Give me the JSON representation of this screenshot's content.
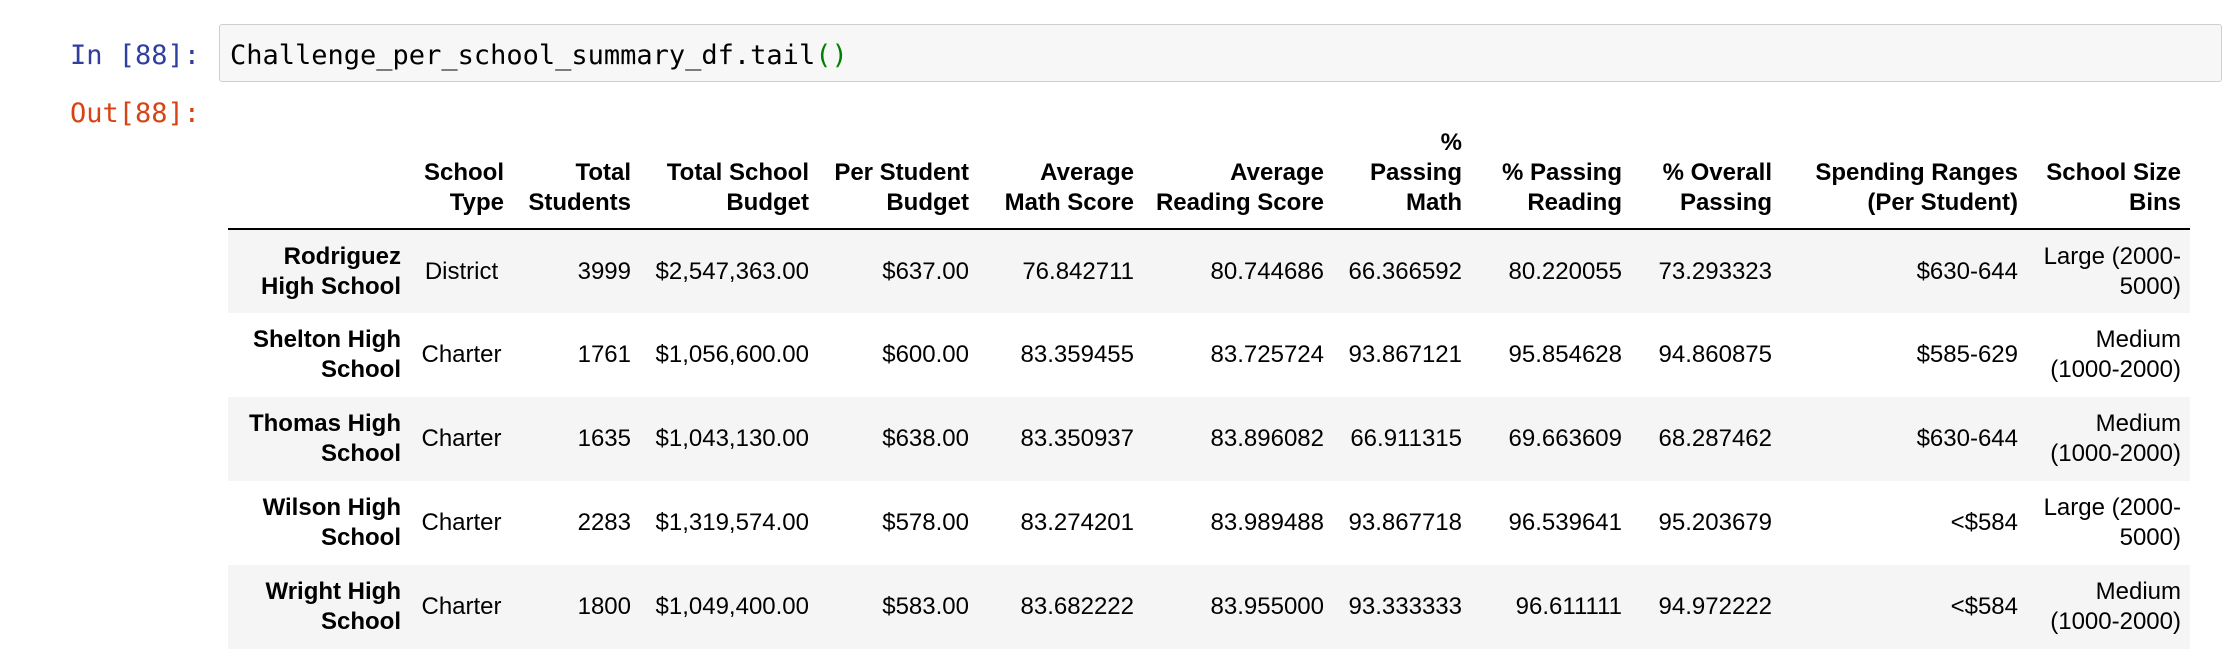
{
  "cell": {
    "in_prompt": "In [88]:",
    "out_prompt": "Out[88]:",
    "code": {
      "text": "Challenge_per_school_summary_df.tail",
      "parens": "()"
    }
  },
  "colors": {
    "in_prompt": "#303f9f",
    "out_prompt": "#d84315",
    "code_parens": "#008000",
    "stripe": "#f5f5f5"
  },
  "table": {
    "columns": [
      "",
      "School Type",
      "Total Students",
      "Total School Budget",
      "Per Student Budget",
      "Average Math Score",
      "Average Reading Score",
      "% Passing Math",
      "% Passing Reading",
      "% Overall Passing",
      "Spending Ranges (Per Student)",
      "School Size Bins"
    ],
    "rows": [
      {
        "index": "Rodriguez High School",
        "cells": [
          "District",
          "3999",
          "$2,547,363.00",
          "$637.00",
          "76.842711",
          "80.744686",
          "66.366592",
          "80.220055",
          "73.293323",
          "$630-644",
          "Large (2000-5000)"
        ]
      },
      {
        "index": "Shelton High School",
        "cells": [
          "Charter",
          "1761",
          "$1,056,600.00",
          "$600.00",
          "83.359455",
          "83.725724",
          "93.867121",
          "95.854628",
          "94.860875",
          "$585-629",
          "Medium (1000-2000)"
        ]
      },
      {
        "index": "Thomas High School",
        "cells": [
          "Charter",
          "1635",
          "$1,043,130.00",
          "$638.00",
          "83.350937",
          "83.896082",
          "66.911315",
          "69.663609",
          "68.287462",
          "$630-644",
          "Medium (1000-2000)"
        ]
      },
      {
        "index": "Wilson High School",
        "cells": [
          "Charter",
          "2283",
          "$1,319,574.00",
          "$578.00",
          "83.274201",
          "83.989488",
          "93.867718",
          "96.539641",
          "95.203679",
          "<$584",
          "Large (2000-5000)"
        ]
      },
      {
        "index": "Wright High School",
        "cells": [
          "Charter",
          "1800",
          "$1,049,400.00",
          "$583.00",
          "83.682222",
          "83.955000",
          "93.333333",
          "96.611111",
          "94.972222",
          "<$584",
          "Medium (1000-2000)"
        ]
      }
    ]
  }
}
